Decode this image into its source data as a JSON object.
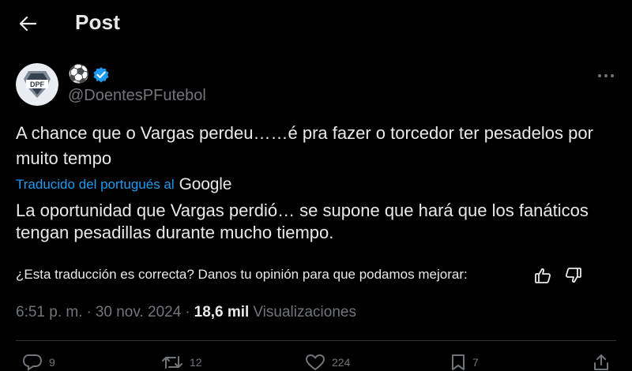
{
  "header": {
    "title": "Post"
  },
  "author": {
    "display_name_emoji": "⚽",
    "verified": true,
    "handle": "@DoentesPFutebol",
    "avatar_text": "DPF"
  },
  "tweet": {
    "text": "A chance que o Vargas perdeu……é pra fazer o torcedor ter pesadelos por muito tempo",
    "translated_from": "Traducido del portugués al",
    "translator": "Google",
    "translation": "La oportunidad que Vargas perdió… se supone que hará que los fanáticos tengan pesadillas durante mucho tiempo.",
    "feedback_prompt": "¿Esta traducción es correcta? Danos tu opinión para que podamos mejorar:",
    "time": "6:51 p. m.",
    "separator": "·",
    "date": "30 nov. 2024",
    "views_count": "18,6 mil",
    "views_label": "Visualizaciones"
  },
  "actions": {
    "reply_count": "9",
    "repost_count": "12",
    "like_count": "224",
    "bookmark_count": "7"
  },
  "colors": {
    "background": "#000000",
    "text": "#e7e9ea",
    "muted": "#71767b",
    "link": "#1d9bf0",
    "verified": "#1d9bf0"
  },
  "icons": [
    "back-arrow-icon",
    "verified-badge-icon",
    "more-icon",
    "thumbs-up-icon",
    "thumbs-down-icon",
    "reply-icon",
    "repost-icon",
    "like-icon",
    "bookmark-icon",
    "share-icon"
  ]
}
